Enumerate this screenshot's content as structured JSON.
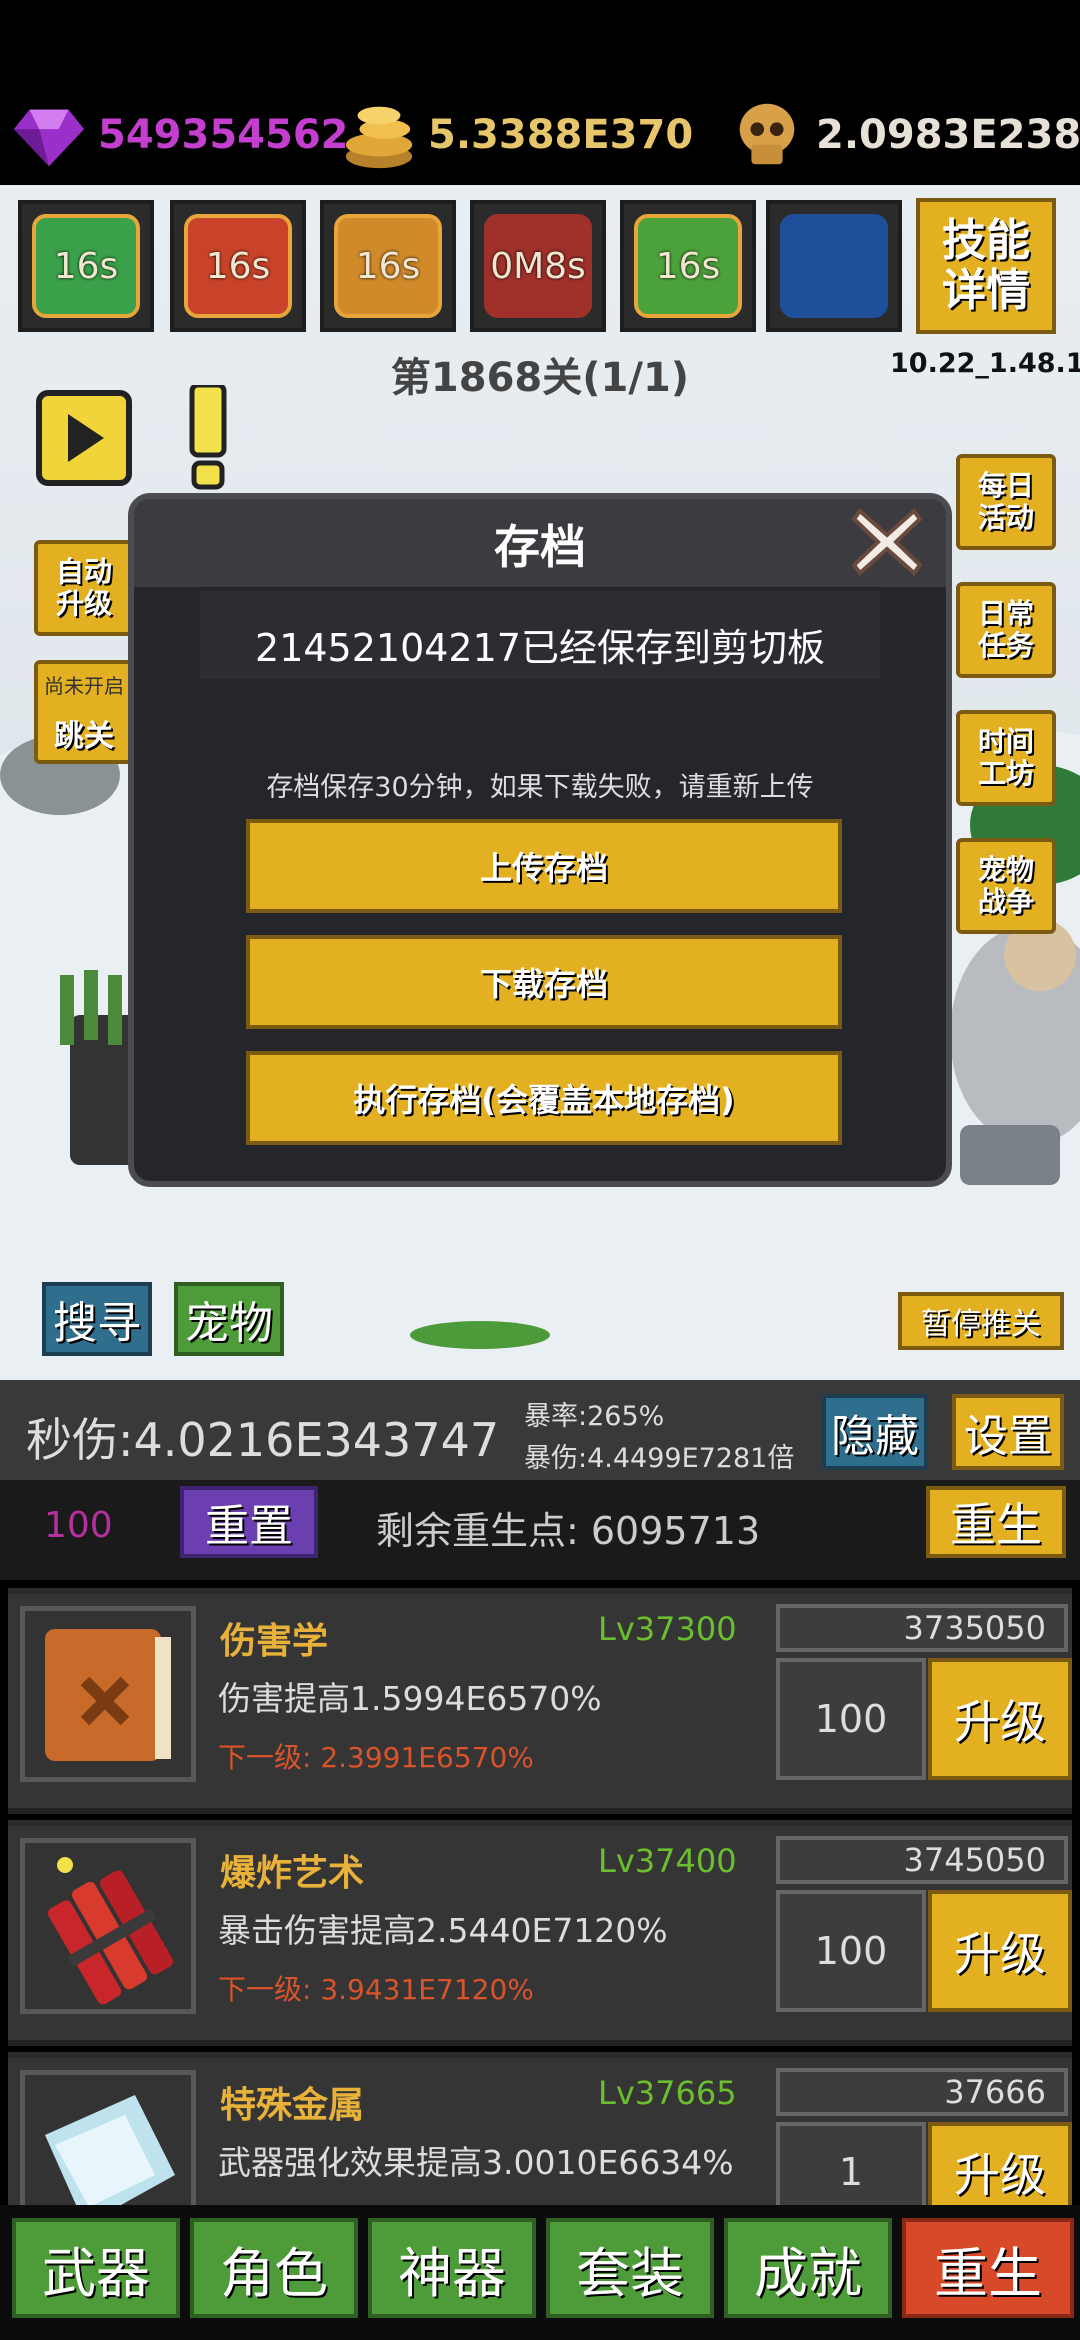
{
  "currencies": {
    "gems": "549354562",
    "gold": "5.3388E370",
    "skulls": "2.0983E238"
  },
  "skills": [
    {
      "label": "16s",
      "color": "#3aa04a"
    },
    {
      "label": "16s",
      "color": "#c8432a"
    },
    {
      "label": "16s",
      "color": "#d08a2a"
    },
    {
      "label": "0M8s",
      "color": "#a0302a"
    },
    {
      "label": "16s",
      "color": "#4ca23a"
    },
    {
      "label": "",
      "color": "#1e4f9a"
    }
  ],
  "skill_detail_button": "技能\n详情",
  "stage": "第1868关(1/1)",
  "version": "10.22_1.48.1",
  "left_buttons": {
    "auto_upgrade": "自动\n升级",
    "skip_note": "尚未开启",
    "skip": "跳关"
  },
  "right_buttons": [
    "每日\n活动",
    "日常\n任务",
    "时间\n工坊",
    "宠物\n战争"
  ],
  "field_buttons": {
    "search": "搜寻",
    "pet": "宠物",
    "pause_push": "暂停推关"
  },
  "modal": {
    "title": "存档",
    "message": "21452104217已经保存到剪切板",
    "note": "存档保存30分钟，如果下载失败，请重新上传",
    "upload": "上传存档",
    "download": "下载存档",
    "execute": "执行存档(会覆盖本地存档)"
  },
  "stats": {
    "dps": "秒伤:4.0216E343747",
    "crit_rate": "暴率:265%",
    "crit_dmg": "暴伤:4.4499E7281倍",
    "hide": "隐藏",
    "settings": "设置"
  },
  "rebirth_row": {
    "count": "100",
    "reset": "重置",
    "points": "剩余重生点: 6095713",
    "rebirth": "重生"
  },
  "cards": [
    {
      "name": "伤害学",
      "level": "Lv37300",
      "desc": "伤害提高1.5994E6570%",
      "next": "下一级: 2.3991E6570%",
      "cost": "3735050",
      "qty": "100",
      "upgrade": "升级"
    },
    {
      "name": "爆炸艺术",
      "level": "Lv37400",
      "desc": "暴击伤害提高2.5440E7120%",
      "next": "下一级: 3.9431E7120%",
      "cost": "3745050",
      "qty": "100",
      "upgrade": "升级"
    },
    {
      "name": "特殊金属",
      "level": "Lv37665",
      "desc": "武器强化效果提高3.0010E6634%",
      "next": "",
      "cost": "37666",
      "qty": "1",
      "upgrade": "升级"
    }
  ],
  "tabs": [
    "武器",
    "角色",
    "神器",
    "套装",
    "成就",
    "重生"
  ]
}
